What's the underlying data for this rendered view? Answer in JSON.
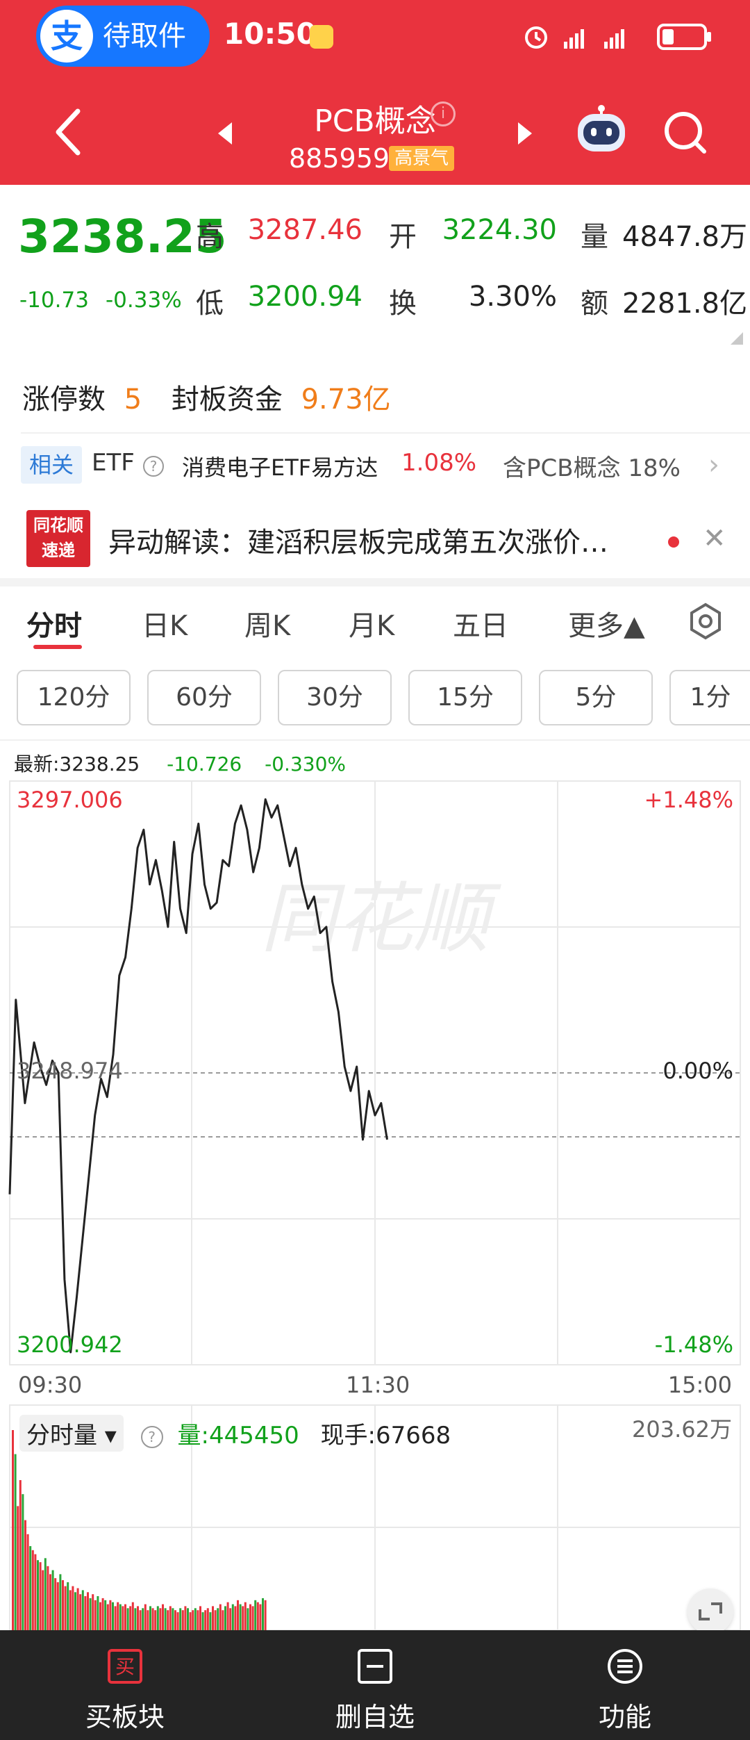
{
  "status_bar": {
    "alipay_icon": "支",
    "alipay_label": "待取件",
    "time": "10:50"
  },
  "header": {
    "stock_name": "PCB概念",
    "stock_code": "885959",
    "hot_badge": "高景气",
    "info_icon": "i"
  },
  "quote": {
    "last_price": "3238.25",
    "change": "-10.73",
    "change_pct": "-0.33%",
    "high_label": "高",
    "high": "3287.46",
    "open_label": "开",
    "open": "3224.30",
    "volume_label": "量",
    "volume": "4847.8万",
    "low_label": "低",
    "low": "3200.94",
    "turnover_label": "换",
    "turnover": "3.30%",
    "amount_label": "额",
    "amount": "2281.8亿"
  },
  "limit": {
    "count_label": "涨停数",
    "count": "5",
    "fund_label": "封板资金",
    "fund": "9.73亿"
  },
  "etf": {
    "badge": "相关",
    "label": "ETF",
    "help": "?",
    "name": "消费电子ETF易方达",
    "pct": "1.08%",
    "contains": "含PCB概念 18%",
    "arrow": "›"
  },
  "news": {
    "logo_line1": "同花顺",
    "logo_line2": "速递",
    "text": "异动解读：建滔积层板完成第五次涨价…",
    "close": "✕"
  },
  "tabs": [
    "分时",
    "日K",
    "周K",
    "月K",
    "五日",
    "更多▲"
  ],
  "periods": [
    "120分",
    "60分",
    "30分",
    "15分",
    "5分",
    "1分"
  ],
  "chart_info": {
    "latest": "最新:3238.25",
    "change": "-10.726",
    "change_pct": "-0.330%"
  },
  "chart_labels": {
    "y_top": "3297.006",
    "y_mid": "3248.974",
    "y_bottom": "3200.942",
    "pct_top": "+1.48%",
    "pct_mid": "0.00%",
    "pct_bottom": "-1.48%",
    "x_start": "09:30",
    "x_mid": "11:30",
    "x_end": "15:00"
  },
  "volume": {
    "selector": "分时量 ▾",
    "help": "?",
    "vol_label": "量:445450",
    "hand_label": "现手:67668",
    "max": "203.62万"
  },
  "bottom_bar": [
    {
      "label": "买板块",
      "icon": "buy-icon",
      "glyph": "买"
    },
    {
      "label": "删自选",
      "icon": "remove-watchlist-icon",
      "glyph": "−"
    },
    {
      "label": "功能",
      "icon": "menu-icon",
      "glyph": "≡"
    }
  ],
  "chart_data": {
    "type": "line",
    "title": "",
    "xlabel": "",
    "ylabel": "",
    "x": [
      "09:30",
      "11:30",
      "15:00"
    ],
    "ylim": [
      3200.942,
      3297.006
    ],
    "prev_close": 3248.974,
    "avg_price": 3238.25,
    "series": [
      {
        "name": "",
        "x_minutes": [
          0,
          2,
          5,
          8,
          10,
          12,
          14,
          16,
          18,
          20,
          22,
          24,
          26,
          28,
          30,
          32,
          34,
          36,
          38,
          40,
          42,
          44,
          46,
          48,
          50,
          52,
          54,
          56,
          58,
          60,
          62,
          64,
          66,
          68,
          70,
          72,
          74,
          76,
          78,
          80,
          82,
          84,
          86,
          88,
          90,
          92,
          94,
          96,
          98,
          100,
          102,
          104,
          106,
          108,
          110,
          112,
          114,
          116,
          118,
          120,
          122,
          124,
          126,
          128,
          130,
          132,
          134,
          136,
          138,
          140,
          142,
          144
        ],
        "values": [
          3229,
          3261,
          3244,
          3254,
          3250,
          3247,
          3251,
          3249,
          3215,
          3203,
          3212,
          3222,
          3232,
          3242,
          3248,
          3245,
          3252,
          3265,
          3268,
          3276,
          3286,
          3289,
          3280,
          3284,
          3279,
          3273,
          3287,
          3276,
          3272,
          3285,
          3290,
          3280,
          3276,
          3277,
          3284,
          3283,
          3290,
          3293,
          3289,
          3282,
          3286,
          3294,
          3291,
          3293,
          3288,
          3283,
          3286,
          3280,
          3276,
          3278,
          3272,
          3273,
          3264,
          3259,
          3250,
          3246,
          3250,
          3238,
          3246,
          3242,
          3244,
          3238
        ]
      }
    ],
    "volume": {
      "max_label": "203.62万",
      "values": [
        100,
        88,
        62,
        75,
        68,
        55,
        48,
        42,
        40,
        38,
        35,
        34,
        30,
        36,
        32,
        28,
        30,
        26,
        24,
        28,
        25,
        22,
        24,
        20,
        22,
        19,
        21,
        18,
        20,
        17,
        19,
        16,
        18,
        15,
        17,
        14,
        16,
        15,
        13,
        15,
        14,
        12,
        14,
        13,
        12,
        13,
        11,
        12,
        14,
        11,
        12,
        10,
        11,
        13,
        10,
        12,
        11,
        10,
        12,
        11,
        13,
        11,
        10,
        12,
        11,
        10,
        9,
        11,
        10,
        12,
        11,
        9,
        10,
        11,
        10,
        12,
        9,
        10,
        11,
        9,
        12,
        10,
        11,
        13,
        10,
        12,
        14,
        11,
        13,
        12,
        15,
        13,
        12,
        14,
        11,
        13,
        12,
        15,
        14,
        13,
        16,
        15
      ]
    }
  }
}
